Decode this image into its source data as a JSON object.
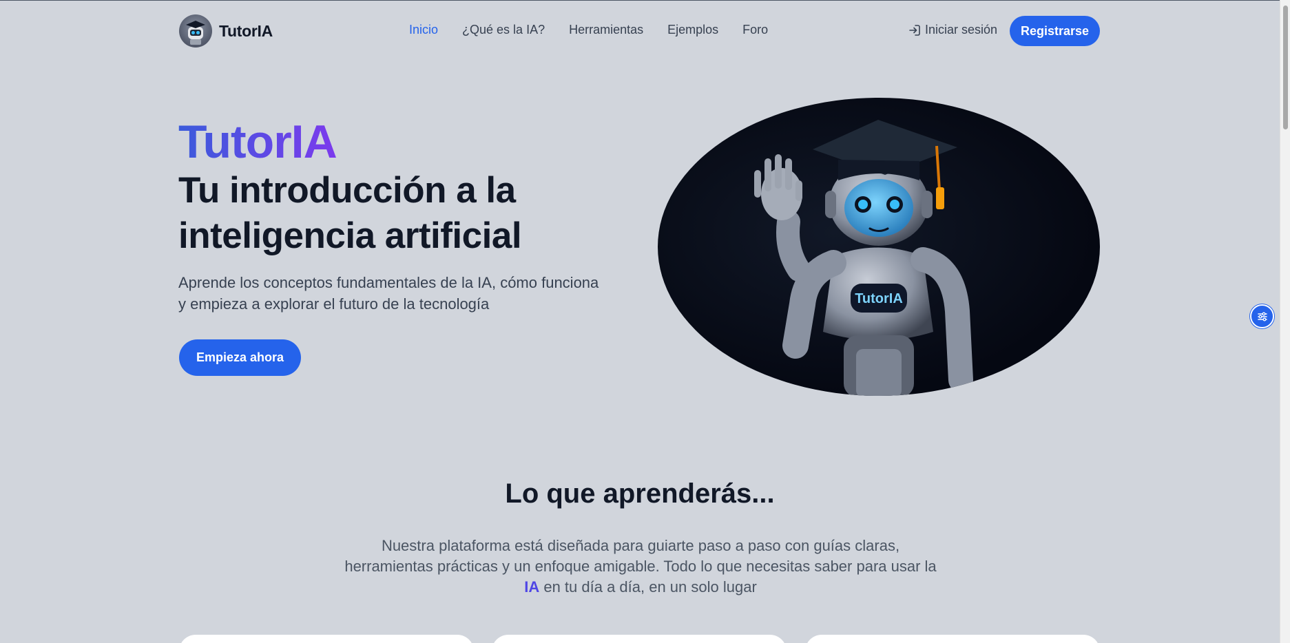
{
  "nav": {
    "brand": "TutorIA",
    "links": [
      "Inicio",
      "¿Qué es la IA?",
      "Herramientas",
      "Ejemplos",
      "Foro"
    ],
    "active_link": "Inicio",
    "login_label": "Iniciar sesión",
    "register_label": "Registrarse"
  },
  "hero": {
    "brand": "TutorIA",
    "title": "Tu introducción a la inteligencia artificial",
    "subtitle": "Aprende los conceptos fundamentales de la IA, cómo funciona y empieza a explorar el futuro de la tecnología",
    "cta_label": "Empieza ahora",
    "robot_badge": "TutorIA"
  },
  "section": {
    "title": "Lo que aprenderás...",
    "text_before": "Nuestra plataforma está diseñada para guiarte paso a paso con guías claras, herramientas prácticas y un enfoque amigable. Todo lo que necesitas saber para usar la ",
    "text_highlight": "IA",
    "text_after": " en tu día a día, en un solo lugar"
  },
  "colors": {
    "accent": "#2563eb",
    "background": "#d1d5dc",
    "brand_gradient_start": "#3b5bdb",
    "brand_gradient_end": "#7c3aed"
  },
  "icons": {
    "login": "login-arrow-icon",
    "settings": "sliders-icon"
  }
}
